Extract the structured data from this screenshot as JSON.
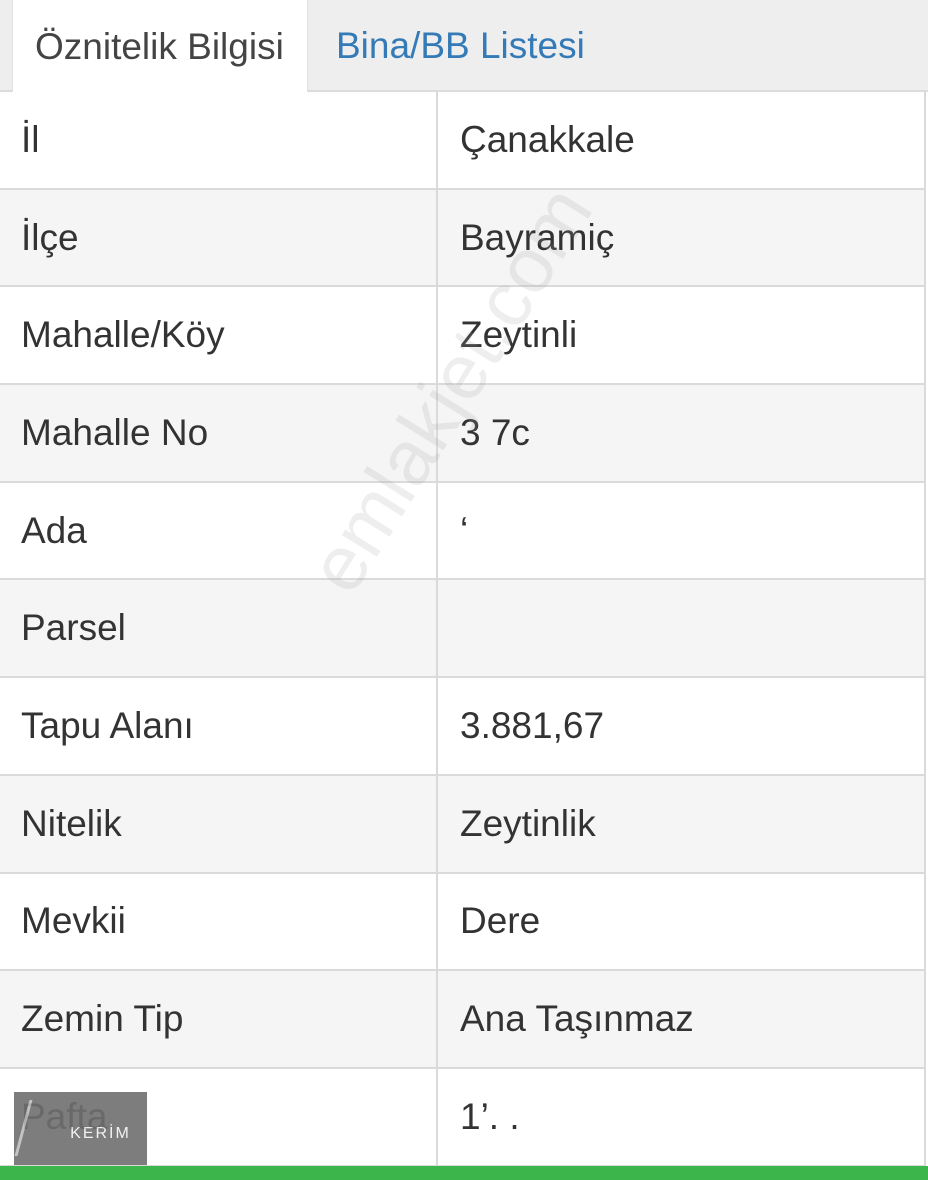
{
  "tabs": [
    {
      "label": "Öznitelik Bilgisi",
      "active": true
    },
    {
      "label": "Bina/BB Listesi",
      "active": false
    }
  ],
  "rows": [
    {
      "label": "İl",
      "value": "Çanakkale"
    },
    {
      "label": "İlçe",
      "value": "Bayramiç"
    },
    {
      "label": "Mahalle/Köy",
      "value": "Zeytinli"
    },
    {
      "label": "Mahalle No",
      "value": "3  7c"
    },
    {
      "label": "Ada",
      "value": "‘"
    },
    {
      "label": "Parsel",
      "value": ""
    },
    {
      "label": "Tapu Alanı",
      "value": "3.881,67"
    },
    {
      "label": "Nitelik",
      "value": "Zeytinlik"
    },
    {
      "label": "Mevkii",
      "value": "Dere"
    },
    {
      "label": "Zemin Tip",
      "value": "Ana Taşınmaz"
    },
    {
      "label": "Pafta",
      "value": "1’.  ."
    }
  ],
  "watermark": "emlakjet.com",
  "logo": {
    "text": "KERİM"
  },
  "colors": {
    "tab_link": "#337ab7",
    "footer_bar": "#3cb54a"
  }
}
